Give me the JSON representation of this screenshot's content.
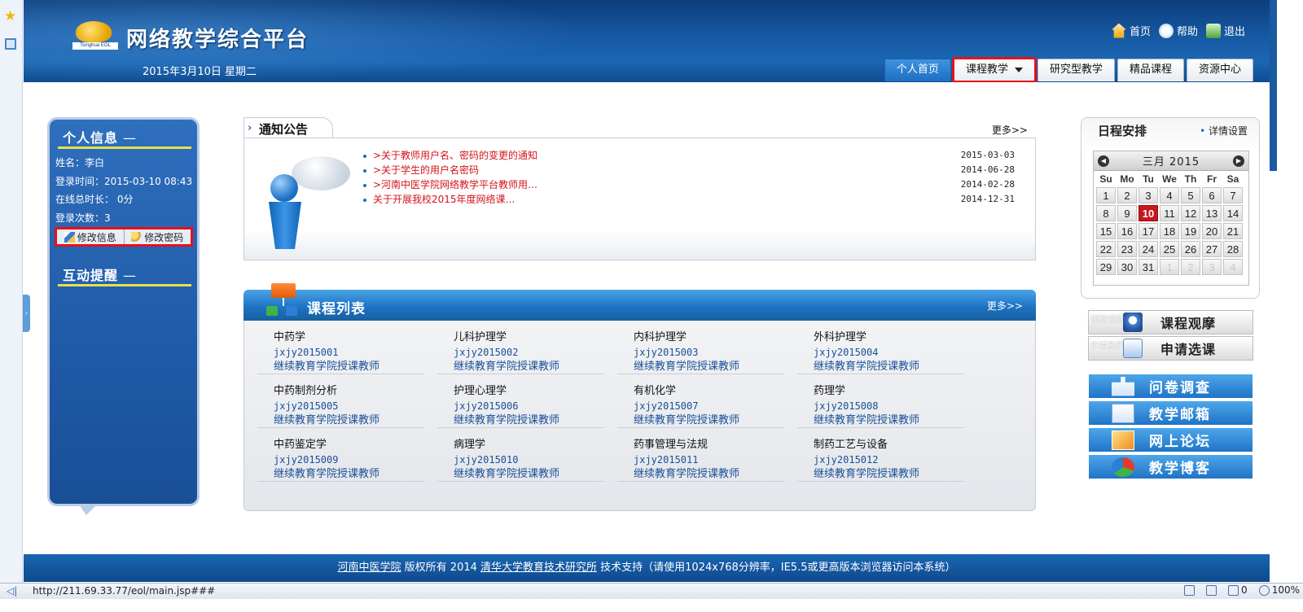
{
  "header": {
    "site_title": "网络教学综合平台",
    "logo_text": "Tsinghua EOL",
    "date": "2015年3月10日 星期二",
    "links": [
      {
        "label": "首页",
        "icon": "home-icon"
      },
      {
        "label": "帮助",
        "icon": "help-icon"
      },
      {
        "label": "退出",
        "icon": "exit-icon"
      }
    ],
    "nav": [
      {
        "label": "个人首页",
        "active": true
      },
      {
        "label": "课程教学",
        "dropdown": true,
        "highlighted": true
      },
      {
        "label": "研究型教学"
      },
      {
        "label": "精品课程"
      },
      {
        "label": "资源中心"
      }
    ]
  },
  "personal": {
    "title": "个人信息",
    "title_dash": "—",
    "name": "姓名：李白",
    "login_time": "登录时间：2015-03-10 08:43",
    "online": "在线总时长： 0分",
    "login_count": "登录次数：3",
    "edit_info": "修改信息",
    "change_password": "修改密码",
    "remind_title": "互动提醒",
    "remind_dash": "—"
  },
  "notices": {
    "title": "通知公告",
    "more": "更多>>",
    "items": [
      {
        "text": ">关于教师用户名、密码的变更的通知",
        "date": "2015-03-03"
      },
      {
        "text": ">关于学生的用户名密码",
        "date": "2014-06-28"
      },
      {
        "text": ">河南中医学院网络教学平台教师用…",
        "date": "2014-02-28"
      },
      {
        "text": "关于开展我校2015年度网络课…",
        "date": "2014-12-31"
      }
    ]
  },
  "courses": {
    "title": "课程列表",
    "more": "更多>>",
    "items": [
      {
        "name": "中药学",
        "code": "jxjy2015001",
        "teacher": "继续教育学院授课教师"
      },
      {
        "name": "儿科护理学",
        "code": "jxjy2015002",
        "teacher": "继续教育学院授课教师"
      },
      {
        "name": "内科护理学",
        "code": "jxjy2015003",
        "teacher": "继续教育学院授课教师"
      },
      {
        "name": "外科护理学",
        "code": "jxjy2015004",
        "teacher": "继续教育学院授课教师"
      },
      {
        "name": "中药制剂分析",
        "code": "jxjy2015005",
        "teacher": "继续教育学院授课教师"
      },
      {
        "name": "护理心理学",
        "code": "jxjy2015006",
        "teacher": "继续教育学院授课教师"
      },
      {
        "name": "有机化学",
        "code": "jxjy2015007",
        "teacher": "继续教育学院授课教师"
      },
      {
        "name": "药理学",
        "code": "jxjy2015008",
        "teacher": "继续教育学院授课教师"
      },
      {
        "name": "中药鉴定学",
        "code": "jxjy2015009",
        "teacher": "继续教育学院授课教师"
      },
      {
        "name": "病理学",
        "code": "jxjy2015010",
        "teacher": "继续教育学院授课教师"
      },
      {
        "name": "药事管理与法规",
        "code": "jxjy2015011",
        "teacher": "继续教育学院授课教师"
      },
      {
        "name": "制药工艺与设备",
        "code": "jxjy2015012",
        "teacher": "继续教育学院授课教师"
      }
    ]
  },
  "calendar": {
    "title": "日程安排",
    "settings": "详情设置",
    "month": "三月 2015",
    "weekdays": [
      "Su",
      "Mo",
      "Tu",
      "We",
      "Th",
      "Fr",
      "Sa"
    ],
    "weeks": [
      [
        "1",
        "2",
        "3",
        "4",
        "5",
        "6",
        "7"
      ],
      [
        "8",
        "9",
        "10",
        "11",
        "12",
        "13",
        "14"
      ],
      [
        "15",
        "16",
        "17",
        "18",
        "19",
        "20",
        "21"
      ],
      [
        "22",
        "23",
        "24",
        "25",
        "26",
        "27",
        "28"
      ],
      [
        "29",
        "30",
        "31",
        "1",
        "2",
        "3",
        "4"
      ]
    ],
    "today": "10"
  },
  "side_buttons": {
    "watch": {
      "label": "课程观摩",
      "ghost": "课程观摩"
    },
    "apply": {
      "label": "申请选课",
      "ghost": "申请选课"
    },
    "blue": [
      {
        "label": "问卷调查",
        "icon": "survey-icon"
      },
      {
        "label": "教学邮箱",
        "icon": "mail-icon"
      },
      {
        "label": "网上论坛",
        "icon": "forum-icon"
      },
      {
        "label": "教学博客",
        "icon": "blog-icon"
      }
    ]
  },
  "footer": {
    "school": "河南中医学院",
    "copyright": " 版权所有 2014 ",
    "support_org": "清华大学教育技术研究所",
    "support_text": " 技术支持（请使用1024x768分辨率，IE5.5或更高版本浏览器访问本系统）"
  },
  "status_bar": {
    "url": "http://211.69.33.77/eol/main.jsp###",
    "zero": "0",
    "zoom": "100%"
  },
  "colors": {
    "header_blue": "#1659a3",
    "active_tab": "#2a80d2",
    "notice_red": "#d3141c",
    "highlight_red": "#e8101a",
    "today_red": "#c8161e"
  }
}
